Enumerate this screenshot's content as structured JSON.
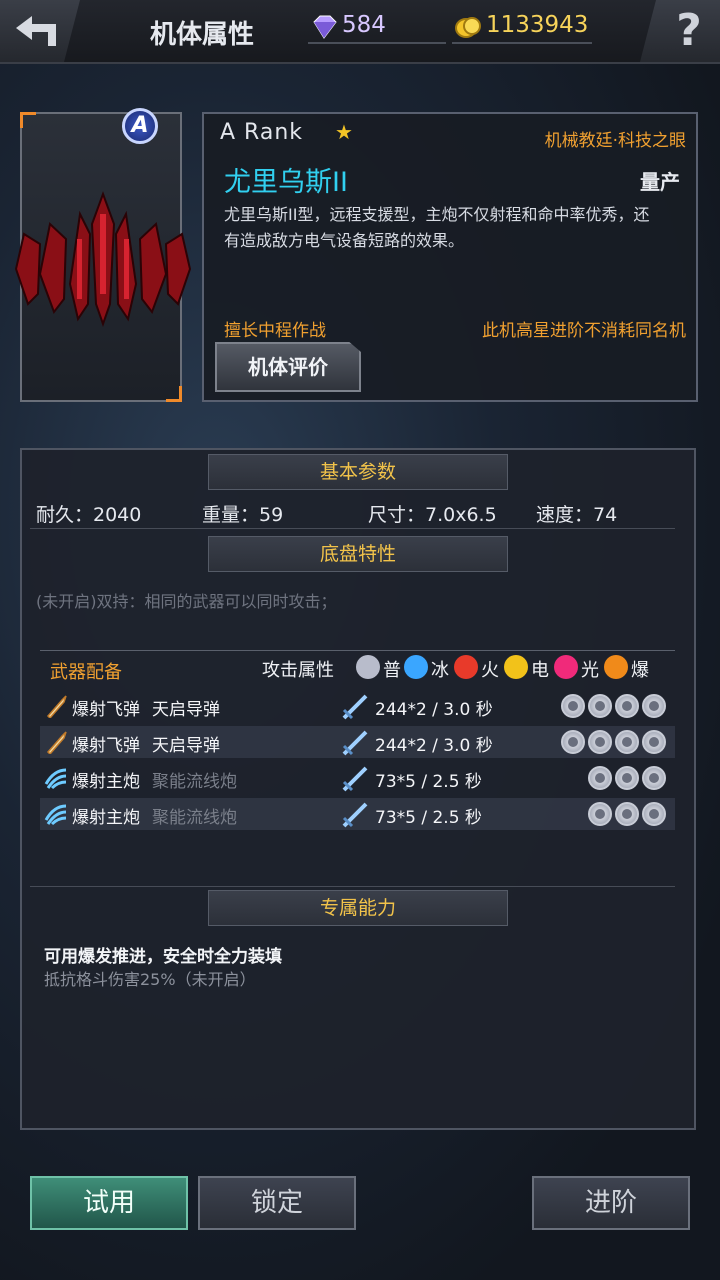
{
  "topbar": {
    "title": "机体属性",
    "gems": "584",
    "gold": "1133943",
    "help": "?"
  },
  "mech": {
    "rank_badge": "A",
    "rank": "A Rank",
    "faction": "机械教廷·科技之眼",
    "name": "尤里乌斯II",
    "production": "量产",
    "description": "尤里乌斯II型，远程支援型，主炮不仅射程和命中率优秀，还有造成敌方电气设备短路的效果。",
    "specialty": "擅长中程作战",
    "star_note": "此机高星进阶不消耗同名机",
    "review_button": "机体评价"
  },
  "basic": {
    "header": "基本参数",
    "durability": "耐久：2040",
    "weight": "重量：59",
    "size": "尺寸：7.0x6.5",
    "speed": "速度：74"
  },
  "chassis": {
    "header": "底盘特性",
    "trait": "(未开启)双持：相同的武器可以同时攻击；"
  },
  "weapons": {
    "title": "武器配备",
    "attack_attr": "攻击属性",
    "elements": [
      {
        "label": "普",
        "color": "#b8bccb"
      },
      {
        "label": "冰",
        "color": "#3aa6ff"
      },
      {
        "label": "火",
        "color": "#e83a2a"
      },
      {
        "label": "电",
        "color": "#f2c21a"
      },
      {
        "label": "光",
        "color": "#f02a7a"
      },
      {
        "label": "爆",
        "color": "#f08a1a"
      }
    ],
    "rows": [
      {
        "type": "爆射飞弹",
        "name": "天启导弹",
        "damage": "244*2 / 3.0 秒",
        "slots": 4,
        "name_active": true,
        "icon": "missile-icon"
      },
      {
        "type": "爆射飞弹",
        "name": "天启导弹",
        "damage": "244*2 / 3.0 秒",
        "slots": 4,
        "name_active": true,
        "icon": "missile-icon"
      },
      {
        "type": "爆射主炮",
        "name": "聚能流线炮",
        "damage": "73*5 / 2.5 秒",
        "slots": 3,
        "name_active": false,
        "icon": "cannon-icon"
      },
      {
        "type": "爆射主炮",
        "name": "聚能流线炮",
        "damage": "73*5 / 2.5 秒",
        "slots": 3,
        "name_active": false,
        "icon": "cannon-icon"
      }
    ]
  },
  "ability": {
    "header": "专属能力",
    "title": "可用爆发推进，安全时全力装填",
    "desc": "抵抗格斗伤害25%（未开启）"
  },
  "buttons": {
    "try": "试用",
    "lock": "锁定",
    "advance": "进阶"
  },
  "colors": {
    "accent_orange": "#f0a030",
    "name_cyan": "#31d0f0",
    "header_gold": "#f2c34a"
  }
}
